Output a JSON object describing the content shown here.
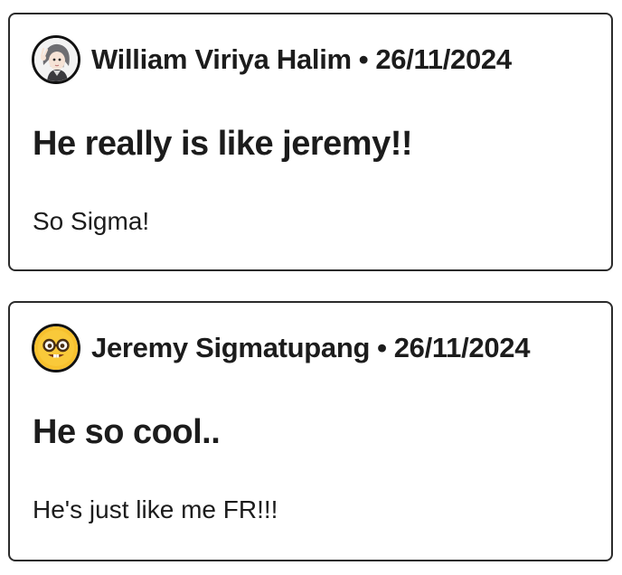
{
  "posts": [
    {
      "author": "William Viriya Halim",
      "separator": "•",
      "date": "26/11/2024",
      "title": "He really is like jeremy!!",
      "body": "So Sigma!",
      "avatar_icon": "anime-character-avatar"
    },
    {
      "author": "Jeremy Sigmatupang",
      "separator": "•",
      "date": "26/11/2024",
      "title": "He so cool..",
      "body": "He's just like me FR!!!",
      "avatar_icon": "nerd-face-emoji-avatar"
    }
  ],
  "colors": {
    "border": "#2b2b2b",
    "text": "#1c1c1c",
    "emoji_yellow": "#f7c12e"
  }
}
